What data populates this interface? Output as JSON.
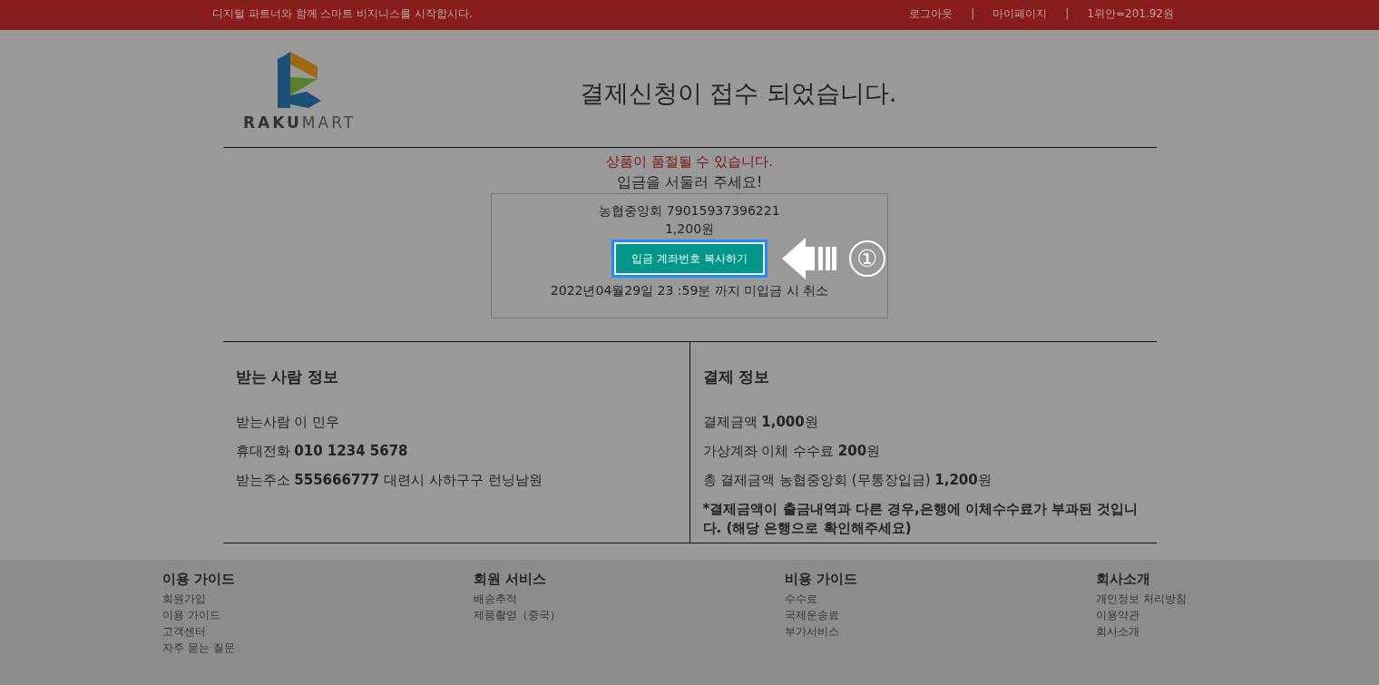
{
  "top_bar": {
    "slogan": "디지털 파트너와 함께 스마트 비지니스를 시작합시다.",
    "items": [
      {
        "kind": "link",
        "text": "로그아웃"
      },
      {
        "kind": "sep",
        "text": "|"
      },
      {
        "kind": "link",
        "text": "마이페이지"
      },
      {
        "kind": "sep",
        "text": "|"
      },
      {
        "kind": "text",
        "text": "1위안=201.92원"
      }
    ]
  },
  "header": {
    "logo": {
      "strong": "RAKU",
      "light": "MART"
    },
    "title": "결제신청이 접수 되었습니다."
  },
  "notice": {
    "warning": "상품이 품절될 수 있습니다.",
    "urge": "입금을 서둘러 주세요!"
  },
  "account_box": {
    "bank_line": "농협중앙회 79015937396221",
    "amount": "1,200원",
    "copy_button": "입금 계좌번호 복사하기",
    "deadline": "2022년04월29일 23 :59분 까지 미입금 시 취소"
  },
  "tutorial": {
    "step": "①"
  },
  "recipient": {
    "title": "받는 사람 정보",
    "lines": [
      "받는사람 이 민우",
      "휴대전화 **010 1234 5678**",
      "받는주소 **555666777** 대련시 사하구구 런닝남원"
    ]
  },
  "payment": {
    "title": "결제 정보",
    "lines": [
      "결제금액 **1,000**원",
      "가상계좌 이체 수수료 **200**원",
      "총 결제금액 농협중앙회 (무통장입금) **1,200**원"
    ],
    "note": "*결제금액이 출금내역과 다른 경우,은행에 이체수수료가 부과된 것입니다. (해당 은행으로 확인해주세요)"
  },
  "footer": [
    {
      "title": "이용 가이드",
      "links": [
        "회원가입",
        "이용 가이드",
        "고객센터",
        "자주 묻는 질문"
      ]
    },
    {
      "title": "회원 서비스",
      "links": [
        "배송추적",
        "제품촬영（중국）"
      ]
    },
    {
      "title": "비용 가이드",
      "links": [
        "수수료",
        "국제운송료",
        "부가서비스"
      ]
    },
    {
      "title": "회사소개",
      "links": [
        "개인정보 처리방침",
        "이용약관",
        "회사소개"
      ]
    }
  ]
}
